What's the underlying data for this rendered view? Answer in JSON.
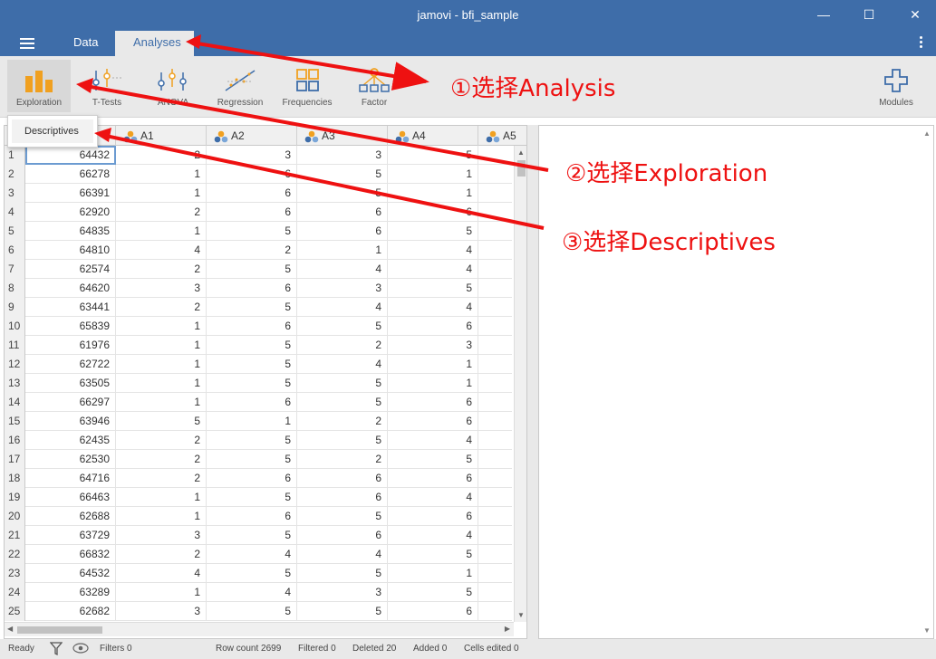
{
  "window": {
    "title": "jamovi - bfi_sample",
    "minimize_glyph": "—",
    "maximize_glyph": "☐",
    "close_glyph": "✕"
  },
  "menu": {
    "tabs": [
      "Data",
      "Analyses"
    ],
    "active_tab": "Analyses"
  },
  "ribbon": {
    "buttons": [
      {
        "label": "Exploration",
        "icon": "exploration-icon"
      },
      {
        "label": "T-Tests",
        "icon": "ttests-icon"
      },
      {
        "label": "ANOVA",
        "icon": "anova-icon"
      },
      {
        "label": "Regression",
        "icon": "regression-icon"
      },
      {
        "label": "Frequencies",
        "icon": "frequencies-icon"
      },
      {
        "label": "Factor",
        "icon": "factor-icon"
      }
    ],
    "modules_label": "Modules"
  },
  "dropdown": {
    "items": [
      "Descriptives"
    ]
  },
  "grid": {
    "columns": [
      "",
      "A1",
      "A2",
      "A3",
      "A4",
      "A5"
    ],
    "rows": [
      [
        "1",
        "64432",
        "2",
        "3",
        "3",
        "5"
      ],
      [
        "2",
        "66278",
        "1",
        "6",
        "5",
        "1"
      ],
      [
        "3",
        "66391",
        "1",
        "6",
        "5",
        "1"
      ],
      [
        "4",
        "62920",
        "2",
        "6",
        "6",
        "6"
      ],
      [
        "5",
        "64835",
        "1",
        "5",
        "6",
        "5"
      ],
      [
        "6",
        "64810",
        "4",
        "2",
        "1",
        "4"
      ],
      [
        "7",
        "62574",
        "2",
        "5",
        "4",
        "4"
      ],
      [
        "8",
        "64620",
        "3",
        "6",
        "3",
        "5"
      ],
      [
        "9",
        "63441",
        "2",
        "5",
        "4",
        "4"
      ],
      [
        "10",
        "65839",
        "1",
        "6",
        "5",
        "6"
      ],
      [
        "11",
        "61976",
        "1",
        "5",
        "2",
        "3"
      ],
      [
        "12",
        "62722",
        "1",
        "5",
        "4",
        "1"
      ],
      [
        "13",
        "63505",
        "1",
        "5",
        "5",
        "1"
      ],
      [
        "14",
        "66297",
        "1",
        "6",
        "5",
        "6"
      ],
      [
        "15",
        "63946",
        "5",
        "1",
        "2",
        "6"
      ],
      [
        "16",
        "62435",
        "2",
        "5",
        "5",
        "4"
      ],
      [
        "17",
        "62530",
        "2",
        "5",
        "2",
        "5"
      ],
      [
        "18",
        "64716",
        "2",
        "6",
        "6",
        "6"
      ],
      [
        "19",
        "66463",
        "1",
        "5",
        "6",
        "4"
      ],
      [
        "20",
        "62688",
        "1",
        "6",
        "5",
        "6"
      ],
      [
        "21",
        "63729",
        "3",
        "5",
        "6",
        "4"
      ],
      [
        "22",
        "66832",
        "2",
        "4",
        "4",
        "5"
      ],
      [
        "23",
        "64532",
        "4",
        "5",
        "5",
        "1"
      ],
      [
        "24",
        "63289",
        "1",
        "4",
        "3",
        "5"
      ],
      [
        "25",
        "62682",
        "3",
        "5",
        "5",
        "6"
      ]
    ]
  },
  "status": {
    "ready": "Ready",
    "filters": "Filters 0",
    "row_count": "Row count 2699",
    "filtered": "Filtered 0",
    "deleted": "Deleted 20",
    "added": "Added 0",
    "cells_edited": "Cells edited 0"
  },
  "annotations": [
    "①选择Analysis",
    "②选择Exploration",
    "③选择Descriptives"
  ],
  "colors": {
    "header_blue": "#3e6da9",
    "annotation_red": "#ee1111",
    "icon_orange": "#f0a020"
  }
}
